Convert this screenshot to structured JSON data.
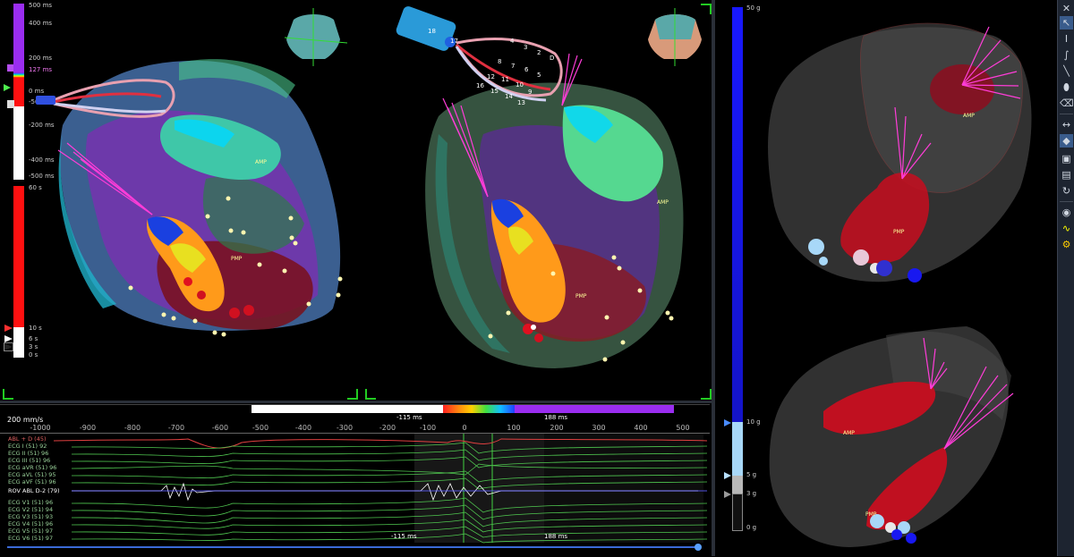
{
  "left_scale": {
    "labels": [
      "500 ms",
      "400 ms",
      "200 ms",
      "127 ms",
      "0 ms",
      "-50 ms",
      "-200 ms",
      "-400 ms",
      "-500 ms"
    ],
    "lower_labels": [
      "60 s",
      "10 s",
      "6 s",
      "3 s",
      "0 s"
    ]
  },
  "right_scale": {
    "labels": [
      "50 g",
      "10 g",
      "5 g",
      "3 g",
      "0 g"
    ]
  },
  "catheter_labels_left": [
    "18",
    "17",
    "4",
    "3",
    "2",
    "D",
    "8",
    "7",
    "6",
    "5",
    "12",
    "11",
    "10",
    "9",
    "16",
    "15",
    "14",
    "13"
  ],
  "map_labels": {
    "amp": "AMP",
    "pmp": "PMP"
  },
  "ecg": {
    "speed": "200 mm/s",
    "ticks": [
      "-1000",
      "-900",
      "-800",
      "-700",
      "-600",
      "-500",
      "-400",
      "-300",
      "-200",
      "-100",
      "0",
      "100",
      "200",
      "300",
      "400",
      "500"
    ],
    "window_left": "-115 ms",
    "window_right": "188 ms",
    "window_left_bottom": "-115 ms",
    "window_right_bottom": "188 ms",
    "channels": [
      "ABL + D (45)",
      "ECG I (51) 92",
      "ECG II (51) 96",
      "ECG III (51) 96",
      "ECG aVR (51) 96",
      "ECG aVL (51) 95",
      "ECG aVF (51) 96",
      "ROV ABL D-2 (79)",
      "ECG V1 (51) 96",
      "ECG V2 (51) 94",
      "ECG V3 (51) 93",
      "ECG V4 (51) 96",
      "ECG V5 (51) 97",
      "ECG V6 (51) 97"
    ]
  },
  "toolbar": {
    "icons": [
      "close-icon",
      "pointer-icon",
      "cursor-text-icon",
      "spline-icon",
      "line-icon",
      "ellipse-icon",
      "eraser-icon",
      "measure-icon",
      "tag-icon",
      "eye-icon",
      "wave-icon",
      "settings-icon"
    ]
  }
}
